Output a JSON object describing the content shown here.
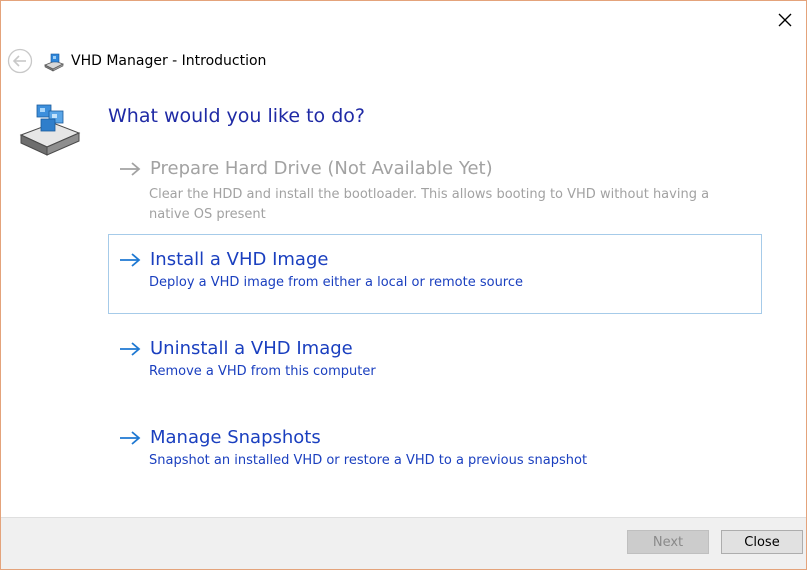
{
  "window": {
    "title": "VHD Manager - Introduction",
    "close_icon": "close-icon",
    "back_icon": "back-arrow-icon",
    "app_icon": "drive-icon"
  },
  "main": {
    "heading": "What would you like to do?",
    "hero_icon": "hard-drive-icon",
    "options": [
      {
        "title": "Prepare Hard Drive (Not Available Yet)",
        "description": "Clear the HDD and install the bootloader. This allows booting to VHD without having a native OS present",
        "enabled": false
      },
      {
        "title": "Install a VHD Image",
        "description": "Deploy a VHD image from either a local or remote source",
        "enabled": true,
        "selected": true
      },
      {
        "title": "Uninstall a VHD Image",
        "description": "Remove a VHD from this computer",
        "enabled": true
      },
      {
        "title": "Manage Snapshots",
        "description": "Snapshot an installed VHD or restore a VHD to a previous snapshot",
        "enabled": true
      }
    ]
  },
  "footer": {
    "next_label": "Next",
    "next_enabled": false,
    "close_label": "Close"
  },
  "colors": {
    "heading": "#1f2aa5",
    "link": "#1a3fbf",
    "arrow": "#1e78d2",
    "disabled": "#a2a2a2",
    "window_border": "#e4a37b",
    "selection_border": "#a6cbe9"
  }
}
